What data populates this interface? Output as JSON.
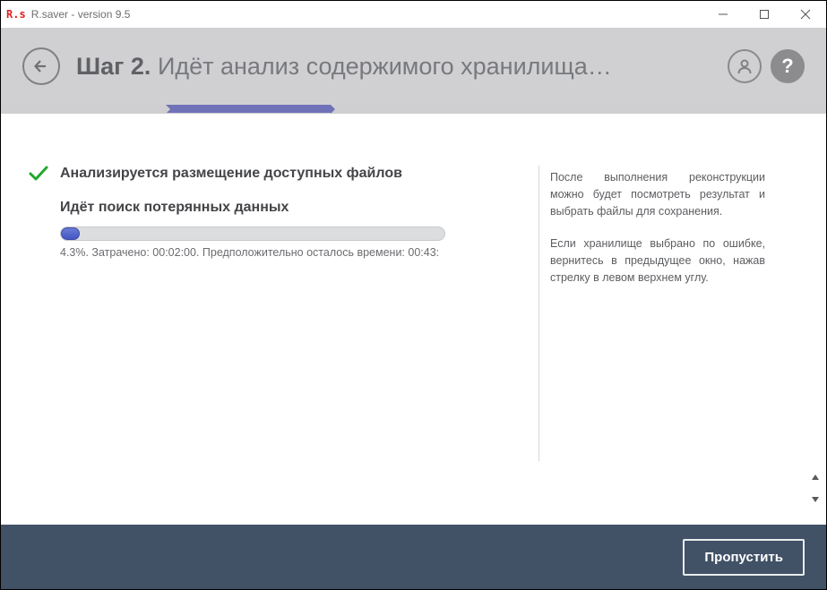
{
  "window": {
    "logo_text": "R.s",
    "title": "R.saver - version 9.5"
  },
  "header": {
    "step_label": "Шаг 2.",
    "title": "Идёт анализ содержимого хранилища…",
    "help_glyph": "?"
  },
  "steps": {
    "total": 5,
    "active_index": 1
  },
  "analysis": {
    "completed_task": "Анализируется размещение доступных файлов",
    "current_task": "Идёт поиск потерянных данных",
    "progress_percent": 4.3,
    "status_line": "4.3%. Затрачено: 00:02:00. Предположительно осталось времени: 00:43:"
  },
  "info": {
    "p1": "После выполнения реконструкции можно будет посмотреть результат и выбрать файлы для сохранения.",
    "p2": "Если хранилище выбрано по ошибке, вернитесь в предыдущее окно, нажав стрелку в левом верхнем углу."
  },
  "footer": {
    "skip_label": "Пропустить"
  }
}
